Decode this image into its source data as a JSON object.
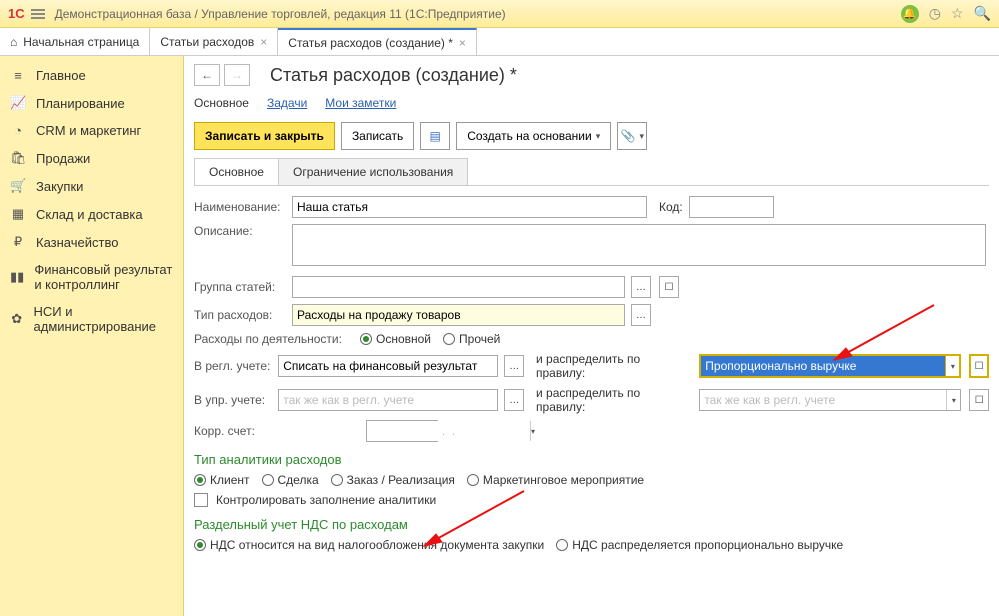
{
  "topbar": {
    "logo": "1С",
    "title": "Демонстрационная база / Управление торговлей, редакция 11   (1С:Предприятие)"
  },
  "tabs": {
    "home": "Начальная страница",
    "t1": "Статьи расходов",
    "t2": "Статья расходов (создание) *"
  },
  "sidebar": {
    "items": [
      {
        "icon": "≡",
        "label": "Главное"
      },
      {
        "icon": "📈",
        "label": "Планирование"
      },
      {
        "icon": "◔",
        "label": "CRM и маркетинг"
      },
      {
        "icon": "🛍",
        "label": "Продажи"
      },
      {
        "icon": "🛒",
        "label": "Закупки"
      },
      {
        "icon": "▦",
        "label": "Склад и доставка"
      },
      {
        "icon": "₽",
        "label": "Казначейство"
      },
      {
        "icon": "▮▮",
        "label": "Финансовый результат и контроллинг"
      },
      {
        "icon": "✿",
        "label": "НСИ и администрирование"
      }
    ]
  },
  "page": {
    "title": "Статья расходов (создание) *",
    "links": {
      "main": "Основное",
      "tasks": "Задачи",
      "notes": "Мои заметки"
    },
    "buttons": {
      "save_close": "Записать и закрыть",
      "save": "Записать",
      "create_by": "Создать на основании"
    },
    "subtabs": {
      "main": "Основное",
      "restrict": "Ограничение использования"
    }
  },
  "form": {
    "name_label": "Наименование:",
    "name_value": "Наша статья",
    "code_label": "Код:",
    "desc_label": "Описание:",
    "group_label": "Группа статей:",
    "type_label": "Тип расходов:",
    "type_value": "Расходы на продажу товаров",
    "activity_label": "Расходы по деятельности:",
    "activity_main": "Основной",
    "activity_other": "Прочей",
    "regl_label": "В регл. учете:",
    "regl_value": "Списать на финансовый результат",
    "distribute_label": "и распределить по правилу:",
    "distribute_value": "Пропорционально выручке",
    "upr_label": "В упр. учете:",
    "upr_placeholder": "так же как в регл. учете",
    "distribute_upr_placeholder": "так же как в регл. учете",
    "korr_label": "Корр. счет:",
    "korr_value": " .  . ",
    "analytics_title": "Тип аналитики расходов",
    "a_client": "Клиент",
    "a_deal": "Сделка",
    "a_order": "Заказ / Реализация",
    "a_event": "Маркетинговое мероприятие",
    "control_fill": "Контролировать заполнение аналитики",
    "nds_title": "Раздельный учет НДС по расходам",
    "nds_opt1": "НДС относится на вид налогообложения документа закупки",
    "nds_opt2": "НДС распределяется пропорционально выручке"
  }
}
